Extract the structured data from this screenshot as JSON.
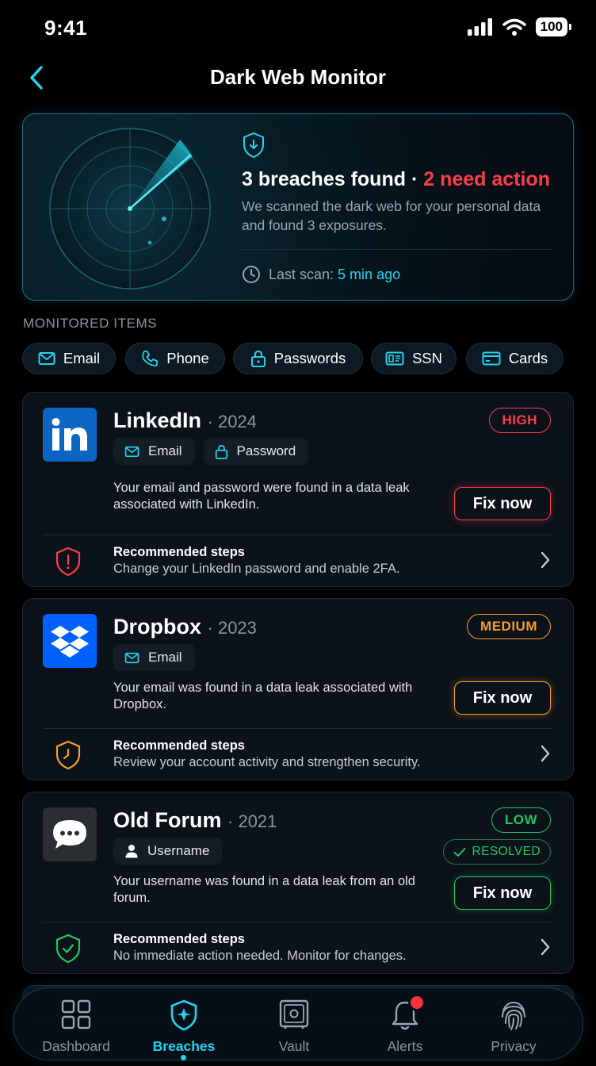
{
  "status": {
    "time": "9:41",
    "battery": "100"
  },
  "header": {
    "title": "Dark Web Monitor"
  },
  "summary": {
    "count_text": "3 breaches found · ",
    "action_text": "2 need action",
    "description": "We scanned the dark web for your personal data and found 3 exposures.",
    "last_scan_label": "Last scan: ",
    "last_scan_value": "5 min ago"
  },
  "monitored": {
    "label": "MONITORED ITEMS",
    "chips": [
      "Email",
      "Phone",
      "Passwords",
      "SSN",
      "Cards"
    ]
  },
  "breaches": [
    {
      "name": "LinkedIn",
      "year": "· 2024",
      "severity": "HIGH",
      "tags": [
        "Email",
        "Password"
      ],
      "description": "Your email and password were found in a data leak associated with LinkedIn.",
      "fix_label": "Fix now",
      "rec_title": "Recommended steps",
      "rec_text": "Change your LinkedIn password and enable 2FA."
    },
    {
      "name": "Dropbox",
      "year": "· 2023",
      "severity": "MEDIUM",
      "tags": [
        "Email"
      ],
      "description": "Your email was found in a data leak associated with Dropbox.",
      "fix_label": "Fix now",
      "rec_title": "Recommended steps",
      "rec_text": "Review your account activity and strengthen security."
    },
    {
      "name": "Old Forum",
      "year": "· 2021",
      "severity": "LOW",
      "status": "RESOLVED",
      "tags": [
        "Username"
      ],
      "description": "Your username was found in a data leak from an old forum.",
      "fix_label": "Fix now",
      "rec_title": "Recommended steps",
      "rec_text": "No immediate action needed. Monitor for changes."
    }
  ],
  "tabs": [
    "Dashboard",
    "Breaches",
    "Vault",
    "Alerts",
    "Privacy"
  ],
  "colors": {
    "accent": "#22d3ee",
    "high": "#ff3b4a",
    "medium": "#f59e2b",
    "low": "#22c55e"
  }
}
